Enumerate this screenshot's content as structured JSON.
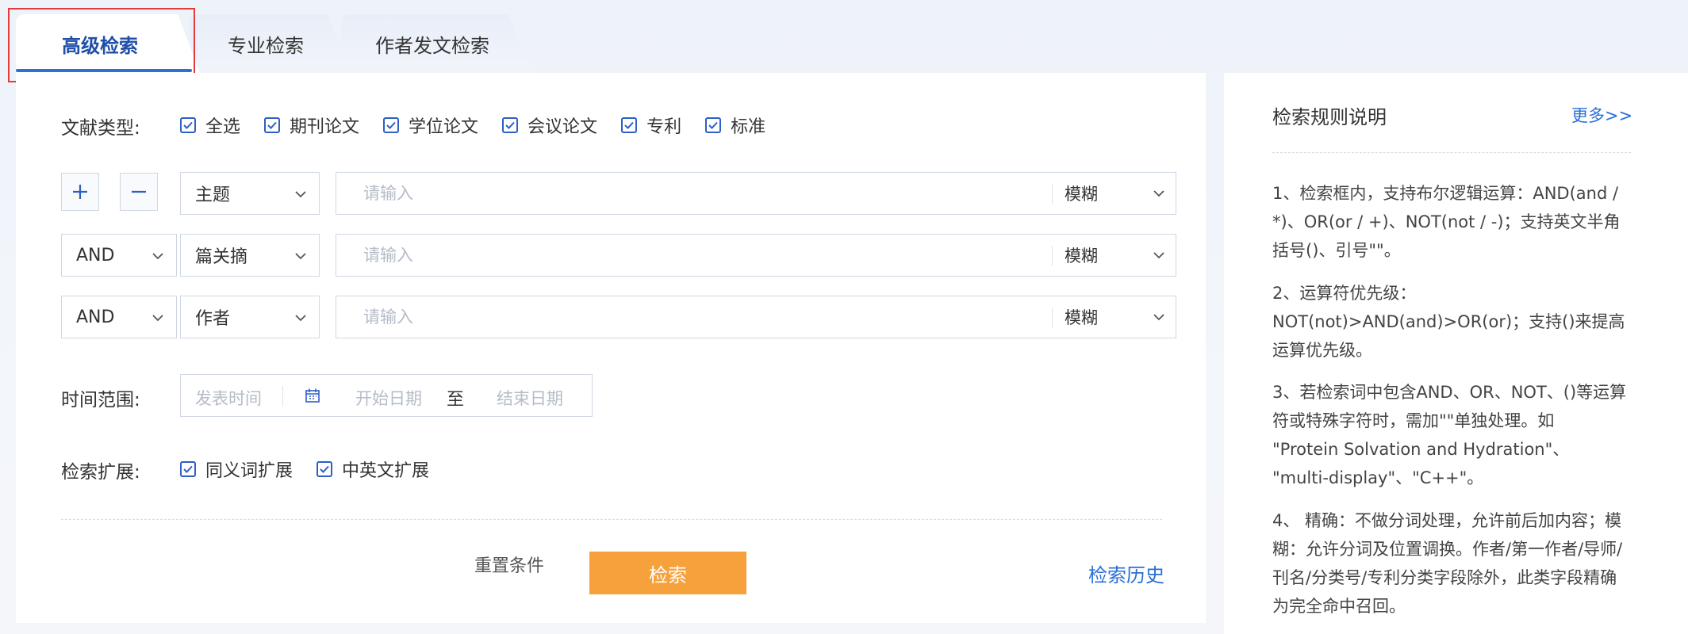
{
  "tabs": [
    {
      "label": "高级检索"
    },
    {
      "label": "专业检索"
    },
    {
      "label": "作者发文检索"
    }
  ],
  "doc_type": {
    "label": "文献类型:",
    "options": [
      {
        "label": "全选",
        "checked": true
      },
      {
        "label": "期刊论文",
        "checked": true
      },
      {
        "label": "学位论文",
        "checked": true
      },
      {
        "label": "会议论文",
        "checked": true
      },
      {
        "label": "专利",
        "checked": true
      },
      {
        "label": "标准",
        "checked": true
      }
    ]
  },
  "query_rows": [
    {
      "logic": "",
      "field": "主题",
      "placeholder": "请输入",
      "mode": "模糊"
    },
    {
      "logic": "AND",
      "field": "篇关摘",
      "placeholder": "请输入",
      "mode": "模糊"
    },
    {
      "logic": "AND",
      "field": "作者",
      "placeholder": "请输入",
      "mode": "模糊"
    }
  ],
  "time_range": {
    "label": "时间范围:",
    "type_placeholder": "发表时间",
    "start_placeholder": "开始日期",
    "to_label": "至",
    "end_placeholder": "结束日期"
  },
  "expansion": {
    "label": "检索扩展:",
    "options": [
      {
        "label": "同义词扩展",
        "checked": true
      },
      {
        "label": "中英文扩展",
        "checked": true
      }
    ]
  },
  "actions": {
    "reset": "重置条件",
    "search": "检索",
    "history": "检索历史"
  },
  "rules_panel": {
    "title": "检索规则说明",
    "more": "更多>>",
    "rules": [
      [
        "1、检索框内，支持布尔逻辑运算：AND(and /",
        "*)、OR(or / +)、NOT(not / -)；支持英文半角",
        "括号()、引号\"\"。"
      ],
      [
        "2、运算符优先级：",
        "NOT(not)>AND(and)>OR(or)；支持()来提高",
        "运算优先级。"
      ],
      [
        "3、若检索词中包含AND、OR、NOT、()等运算",
        "符或特殊字符时，需加\"\"单独处理。如",
        "\"Protein Solvation and Hydration\"、",
        "\"multi-display\"、\"C++\"。"
      ],
      [
        "4、 精确：不做分词处理，允许前后加内容；模",
        "糊：允许分词及位置调换。作者/第一作者/导师/",
        "刊名/分类号/专利分类字段除外，此类字段精确",
        "为完全命中召回。"
      ]
    ]
  },
  "colors": {
    "accent": "#2d6fd7",
    "search_button": "#f7a13c",
    "link": "#2a6fd6",
    "highlight_border": "#e53a3a"
  },
  "icons": [
    "plus-icon",
    "minus-icon",
    "chevron-down-icon",
    "calendar-icon",
    "checkmark-icon"
  ]
}
